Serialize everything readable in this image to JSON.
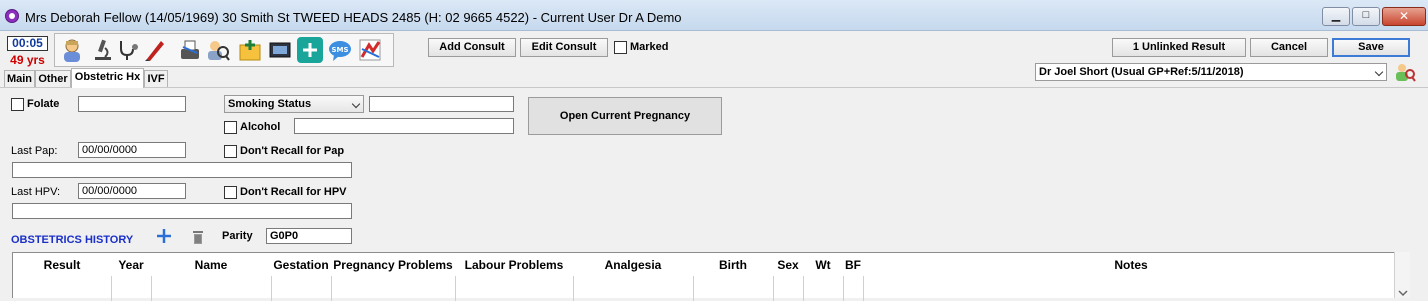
{
  "window": {
    "title": "Mrs Deborah Fellow (14/05/1969) 30 Smith St TWEED HEADS 2485 (H: 02 9665 4522) - Current User Dr A Demo",
    "minimize_glyph": "▁",
    "maximize_glyph": "□",
    "close_glyph": "✕"
  },
  "clock": {
    "time": "00:05",
    "age": "49 yrs"
  },
  "toolbar_icons": [
    "patient-icon",
    "microscope-icon",
    "stethoscope-icon",
    "pen-icon",
    "fax-icon",
    "search-user-icon",
    "referral-icon",
    "image-icon",
    "add-icon",
    "sms-icon",
    "chart-icon"
  ],
  "actions": {
    "add_consult": "Add Consult",
    "edit_consult": "Edit Consult",
    "marked": "Marked",
    "unlinked_result": "1 Unlinked Result",
    "cancel": "Cancel",
    "save": "Save"
  },
  "tabs": [
    "Main",
    "Other",
    "Obstetric Hx",
    "IVF"
  ],
  "doctor_select": "Dr Joel Short (Usual GP+Ref:5/11/2018)",
  "form": {
    "folate_label": "Folate",
    "folate_value": "",
    "smoking_select": "Smoking Status",
    "smoking_value": "",
    "alcohol_label": "Alcohol",
    "alcohol_value": "",
    "open_pregnancy": "Open Current Pregnancy",
    "last_pap_label": "Last Pap:",
    "last_pap_value": "00/00/0000",
    "pap_recall": "Don't Recall for Pap",
    "pap_notes": "",
    "last_hpv_label": "Last HPV:",
    "last_hpv_value": "00/00/0000",
    "hpv_recall": "Don't Recall for HPV",
    "hpv_notes": ""
  },
  "history": {
    "title": "OBSTETRICS HISTORY",
    "parity_label": "Parity",
    "parity_value": "G0P0",
    "columns": [
      "Result",
      "Year",
      "Name",
      "Gestation",
      "Pregnancy Problems",
      "Labour Problems",
      "Analgesia",
      "Birth",
      "Sex",
      "Wt",
      "BF",
      "Notes"
    ],
    "rows": []
  }
}
